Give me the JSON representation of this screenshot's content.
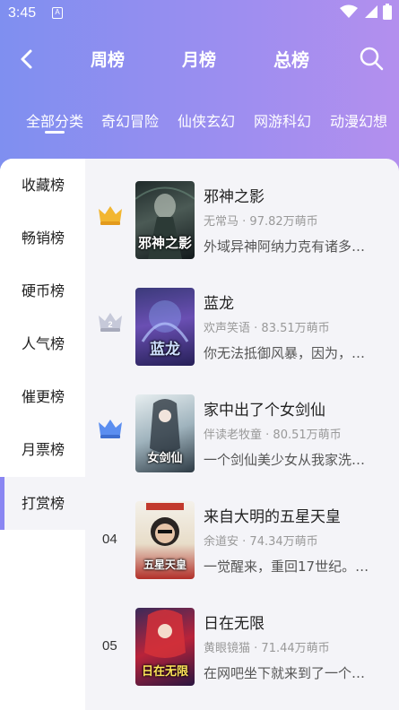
{
  "status_bar": {
    "time": "3:45",
    "notification": "A"
  },
  "nav": {
    "tabs": [
      {
        "label": "周榜"
      },
      {
        "label": "月榜"
      },
      {
        "label": "总榜"
      }
    ]
  },
  "categories": [
    {
      "label": "全部分类"
    },
    {
      "label": "奇幻冒险"
    },
    {
      "label": "仙侠玄幻"
    },
    {
      "label": "网游科幻"
    },
    {
      "label": "动漫幻想"
    }
  ],
  "sidebar": {
    "items": [
      {
        "label": "收藏榜"
      },
      {
        "label": "畅销榜"
      },
      {
        "label": "硬币榜"
      },
      {
        "label": "人气榜"
      },
      {
        "label": "催更榜"
      },
      {
        "label": "月票榜"
      },
      {
        "label": "打赏榜"
      }
    ],
    "active_index": 6
  },
  "books": [
    {
      "rank": "1",
      "rank_badge": "gold-crown-icon",
      "title": "邪神之影",
      "author": "无常马",
      "coins": "97.82万萌币",
      "desc": "外域异神阿纳力克有诸多…",
      "cover_text": "邪神之影"
    },
    {
      "rank": "2",
      "rank_badge": "silver-crown-icon",
      "title": "蓝龙",
      "author": "欢声笑语",
      "coins": "83.51万萌币",
      "desc": "你无法抵御风暴，因为，…",
      "cover_text": "蓝龙"
    },
    {
      "rank": "3",
      "rank_badge": "blue-crown-icon",
      "title": "家中出了个女剑仙",
      "author": "伴读老牧童",
      "coins": "80.51万萌币",
      "desc": "一个剑仙美少女从我家洗…",
      "cover_text": "女剑仙"
    },
    {
      "rank": "04",
      "title": "来自大明的五星天皇",
      "author": "余道安",
      "coins": "74.34万萌币",
      "desc": "一觉醒来，重回17世纪。…",
      "cover_text": "五星天皇"
    },
    {
      "rank": "05",
      "title": "日在无限",
      "author": "黄眼镜猫",
      "coins": "71.44万萌币",
      "desc": "在网吧坐下就来到了一个…",
      "cover_text": "日在无限"
    }
  ],
  "colors": {
    "accent": "#8a86f2",
    "header_start": "#7f8ff0",
    "header_end": "#b38fee",
    "gold": "#f2b631",
    "silver": "#b9bccf",
    "blue": "#5b8ef0"
  }
}
